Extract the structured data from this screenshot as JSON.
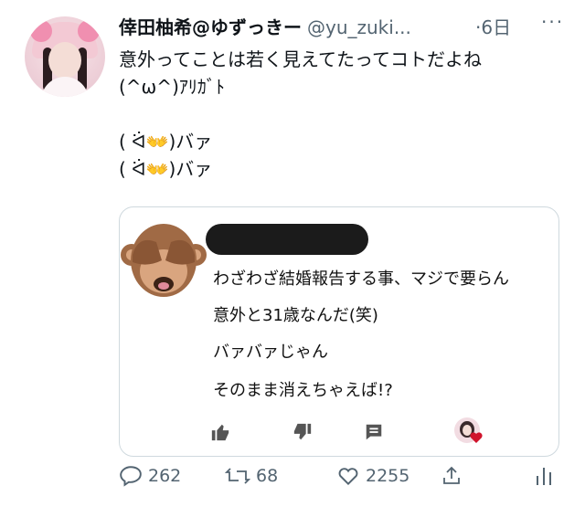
{
  "tweet": {
    "author_name": "倖田柚希@ゆずっきー",
    "handle": "@yu_zuki...",
    "time": "·6日",
    "more_icon": "more-horizontal-icon",
    "text": "意外ってことは若く見えてたってコトだよね\n(^ω^)ｱﾘｶﾞﾄ\n\n( ᐛ👐)バァ\n( ᐛ👐)バァ"
  },
  "quoted_reply": {
    "avatar_icon": "see-no-evil-monkey-icon",
    "author_redacted": true,
    "lines": [
      "わざわざ結婚報告する事、マジで要らん",
      "意外と31歳なんだ(笑)",
      "バァバァじゃん",
      "そのまま消えちゃえば!?"
    ],
    "actions": [
      "thumbs-up-icon",
      "thumbs-down-icon",
      "comment-icon",
      "avatar-heart-icon"
    ]
  },
  "footer": {
    "replies": "262",
    "retweets": "68",
    "likes": "2255",
    "icons": [
      "reply-icon",
      "retweet-icon",
      "like-icon",
      "share-icon",
      "analytics-icon"
    ]
  },
  "colors": {
    "text": "#0f1419",
    "secondary": "#536471",
    "border": "#cfd9de",
    "monkey": "#a06a45"
  }
}
